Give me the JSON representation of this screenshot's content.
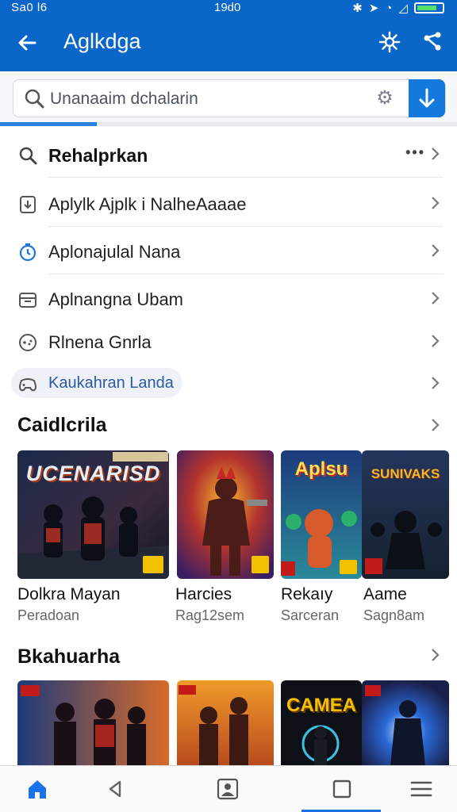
{
  "status_bar": {
    "time": "Sa0 l6",
    "center": "19d0"
  },
  "app_bar": {
    "title": "Aglkdga"
  },
  "search": {
    "placeholder": "Unanaaim dchalarin"
  },
  "menu": {
    "items": [
      {
        "label": "Rehalprkan",
        "icon": "search-icon"
      },
      {
        "label": "Aplylk Ajplk i NalheAaaae",
        "icon": "app-download-icon"
      },
      {
        "label": "Aplonajulal Nana",
        "icon": "clock-icon"
      },
      {
        "label": "Aplnangna Ubam",
        "icon": "folder-icon"
      },
      {
        "label": "Rlnena Gnrla",
        "icon": "gamepad-icon"
      },
      {
        "label": "Kaukahran Landa",
        "icon": "controller-icon"
      }
    ]
  },
  "section_1": {
    "title": "Caidlcrila",
    "games": [
      {
        "name": "Dolkra Mayan",
        "subtitle": "Peradoan",
        "art_title": "UCENARISD",
        "badge": "1+",
        "accent": "#f2c200"
      },
      {
        "name": "Harcies",
        "subtitle": "Rag12sem",
        "art_title": "",
        "badge": "1+",
        "accent": "#f2c200"
      },
      {
        "name": "Rekaıy",
        "subtitle": "Sarceran",
        "art_title": "Aplsu",
        "badge": "1+",
        "accent": "#f2c200"
      },
      {
        "name": "Aame",
        "subtitle": "Sagn8am",
        "art_title": "SUNIVAKS",
        "badge": "",
        "accent": "#c31a1a"
      }
    ]
  },
  "section_2": {
    "title": "Bkahuarha",
    "games": [
      {
        "art_title": ""
      },
      {
        "art_title": ""
      },
      {
        "art_title": "CAMEA"
      },
      {
        "art_title": ""
      }
    ]
  },
  "colors": {
    "primary": "#0a66c8",
    "accent": "#1479dc",
    "nav_active": "#1a73e8"
  }
}
